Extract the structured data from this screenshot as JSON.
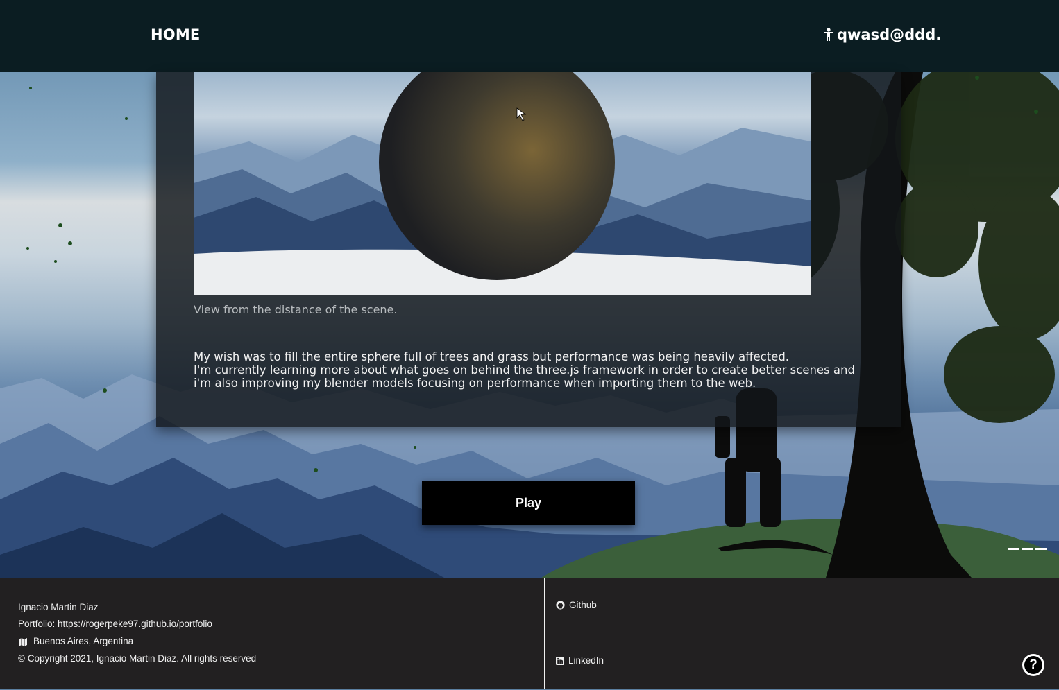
{
  "nav": {
    "home_label": "HOME",
    "user_email": "qwasd@ddd.co"
  },
  "article": {
    "image_caption": "View from the distance of the scene.",
    "paragraph_line1": "My wish was to fill the entire sphere full of trees and grass but performance was being heavily affected.",
    "paragraph_line2": "I'm currently learning more about what goes on behind the three.js framework in order to create better scenes and i'm also improving my blender models focusing on performance when importing them to the web."
  },
  "controls": {
    "play_label": "Play"
  },
  "footer": {
    "author": "Ignacio Martin Diaz",
    "portfolio_prefix": "Portfolio: ",
    "portfolio_link": "https://rogerpeke97.github.io/portfolio",
    "location": "Buenos Aires, Argentina",
    "copyright": "© Copyright 2021, Ignacio Martin Diaz. All rights reserved",
    "github_label": "Github",
    "linkedin_label": "LinkedIn",
    "help_label": "?"
  },
  "icons": {
    "user": "user-icon",
    "location": "map-icon",
    "github": "github-icon",
    "linkedin": "linkedin-icon",
    "help": "help-icon"
  }
}
